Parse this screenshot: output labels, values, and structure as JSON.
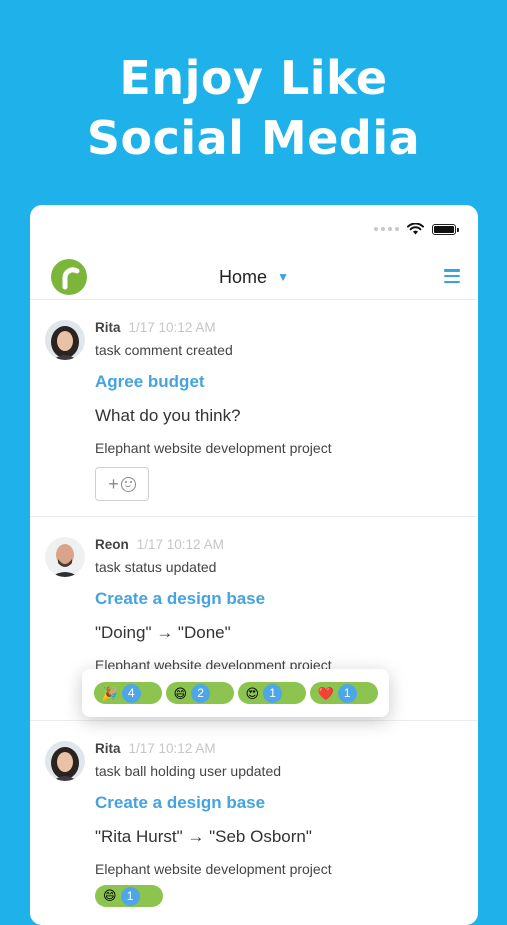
{
  "promo": {
    "line1": "Enjoy Like",
    "line2": "Social Media"
  },
  "navbar": {
    "title": "Home"
  },
  "feed": [
    {
      "user": "Rita",
      "time": "1/17 10:12 AM",
      "action": "task comment created",
      "task": "Agree budget",
      "body": "What do you think?",
      "project": "Elephant website development project"
    },
    {
      "user": "Reon",
      "time": "1/17 10:12 AM",
      "action": "task status updated",
      "task": "Create a design base",
      "body": "\"Doing\" → \"Done\"",
      "project": "Elephant website development project"
    },
    {
      "user": "Rita",
      "time": "1/17 10:12 AM",
      "action": "task ball holding user updated",
      "task": "Create a design base",
      "body": "\"Rita Hurst\" → \"Seb Osborn\"",
      "project": "Elephant website development project"
    }
  ],
  "reactions": [
    {
      "emoji": "🎉",
      "count": "4"
    },
    {
      "emoji": "😄",
      "count": "2"
    },
    {
      "emoji": "😍",
      "count": "1"
    },
    {
      "emoji": "❤️",
      "count": "1"
    }
  ],
  "partial_reaction": {
    "emoji": "😄",
    "count": "1"
  },
  "colors": {
    "background": "#1fb1ea",
    "accent": "#45a3e0",
    "logo": "#7bb53a",
    "reaction_pill": "#8cc44f"
  }
}
